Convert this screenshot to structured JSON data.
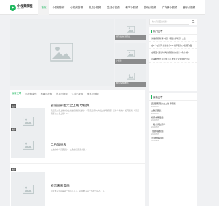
{
  "header": {
    "logo_title": "小视频教程",
    "logo_sub": "xsp.com",
    "nav": [
      "首页",
      "小视频制作",
      "小视频剪辑",
      "热点小视频",
      "生活小视频",
      "教学小视频",
      "游戏小视频",
      "广场舞小视频",
      "音乐小视频",
      "动漫视频"
    ]
  },
  "featured": [
    "腾讯视频的首页推",
    "小视频",
    "腾讯小视频推荐"
  ],
  "search": {
    "placeholder": "输入你想要的视频..."
  },
  "hot": {
    "heading": "热门文章",
    "items": [
      "快播视频教程: 电影《复仇者联盟》全集",
      "在1个电影同,婆婆操作PS 推荐其他小视频作品",
      "在哪里?其他时间的视频制作用什么软件好?",
      "百事制作分享影像:《红楼梦》全套剪辑分享"
    ]
  },
  "latest": {
    "heading": "最新文章",
    "items": [
      {
        "title": "霸道圆形图大全上线 母视频",
        "date": "2019/05/25"
      },
      {
        "title": "二胎演员表",
        "date": "2019/05/25"
      },
      {
        "title": "初音未来漫画",
        "date": "2019/05/25"
      },
      {
        "title": "一段小学生同学",
        "date": "2019/05/25"
      },
      {
        "title": "下载抖音视频",
        "date": "2019/05/25"
      },
      {
        "title": "沙漠旅游动图",
        "date": "2019/05/25"
      }
    ]
  },
  "tabs": [
    "最新文章",
    "小视频制作",
    "有趣小视频",
    "热点小视频",
    "生活小视频",
    "教学小视频"
  ],
  "posts": [
    {
      "badge": "推荐",
      "title": "霸道圆形图大全上线 母视频",
      "desc": "看起来大家上线大全上线的圆视频好的小 《霸道是帮你大全上线 母视频》是什么样的？ 如何看到 《霸道圆帮你大全上线》 1..."
    },
    {
      "badge": "推荐",
      "title": "二胎演员表",
      "desc": "二胎的什么演员表小，二胎的演员表小说 1..."
    },
    {
      "badge": "推荐",
      "title": "初音未来漫画",
      "desc": "初音未来漫画是第一部有几人了，初音未来是一部有什么人？ 1..."
    }
  ]
}
